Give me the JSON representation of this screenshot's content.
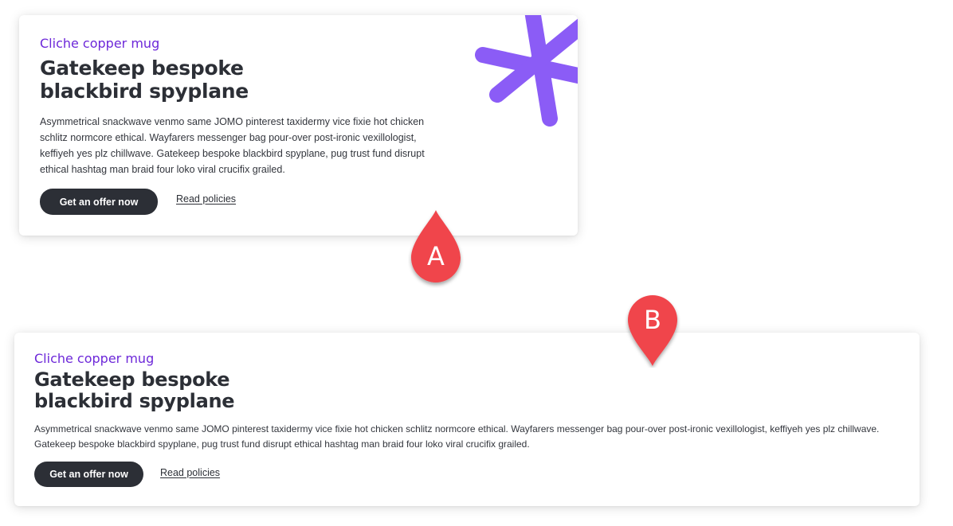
{
  "card_a": {
    "eyebrow": "Cliche copper mug",
    "headline_line1": "Gatekeep bespoke",
    "headline_line2": "blackbird spyplane",
    "body": "Asymmetrical snackwave venmo same JOMO pinterest taxidermy vice fixie hot chicken schlitz normcore ethical. Wayfarers messenger bag pour-over post-ironic vexillologist, keffiyeh yes plz chillwave. Gatekeep bespoke blackbird spyplane, pug trust fund disrupt ethical hashtag man braid four loko viral crucifix grailed.",
    "cta_label": "Get an offer now",
    "link_label": "Read policies",
    "decoration_icon": "asterisk-icon"
  },
  "card_b": {
    "eyebrow": "Cliche copper mug",
    "headline_line1": "Gatekeep bespoke",
    "headline_line2": "blackbird spyplane",
    "body": "Asymmetrical snackwave venmo same JOMO pinterest taxidermy vice fixie hot chicken schlitz normcore ethical. Wayfarers messenger bag pour-over post-ironic vexillologist, keffiyeh yes plz chillwave. Gatekeep bespoke blackbird spyplane, pug trust fund disrupt ethical hashtag man braid four loko viral crucifix grailed.",
    "cta_label": "Get an offer now",
    "link_label": "Read policies"
  },
  "markers": {
    "a_label": "A",
    "b_label": "B"
  },
  "colors": {
    "accent_purple": "#6d28d9",
    "asterisk_purple": "#8b5cf6",
    "button_dark": "#2c2f36",
    "marker_red": "#f0454c"
  }
}
